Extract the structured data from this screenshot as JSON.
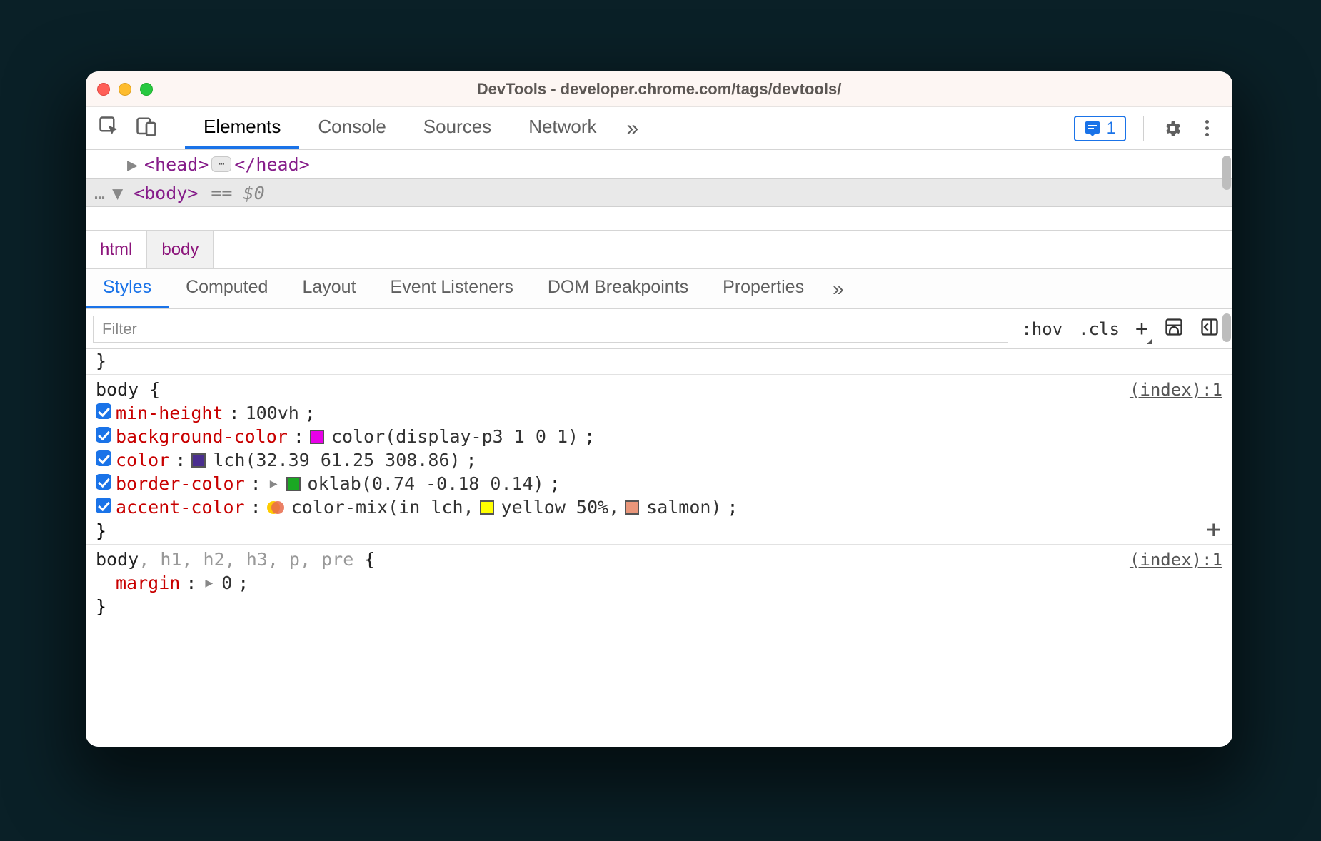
{
  "window": {
    "title": "DevTools - developer.chrome.com/tags/devtools/"
  },
  "main_tabs": {
    "items": [
      "Elements",
      "Console",
      "Sources",
      "Network"
    ],
    "active_index": 0,
    "overflow_glyph": "»"
  },
  "issue_chip": {
    "count": "1"
  },
  "dom": {
    "head_open": "<head>",
    "head_close": "</head>",
    "head_badge": "⋯",
    "body_open": "<body>",
    "eq_prefix": "==",
    "eq_var": "$0",
    "selected_dots": "…"
  },
  "breadcrumb": {
    "items": [
      "html",
      "body"
    ],
    "active_index": 1
  },
  "sub_tabs": {
    "items": [
      "Styles",
      "Computed",
      "Layout",
      "Event Listeners",
      "DOM Breakpoints",
      "Properties"
    ],
    "active_index": 0,
    "overflow_glyph": "»"
  },
  "filterbar": {
    "placeholder": "Filter",
    "hov": ":hov",
    "cls": ".cls",
    "plus": "+"
  },
  "rules": [
    {
      "selector_main": "body",
      "selector_dim": "",
      "open": "{",
      "close": "}",
      "source": "(index):1",
      "show_add": true,
      "declarations": [
        {
          "checked": true,
          "prop": "min-height",
          "value_plain": "100vh"
        },
        {
          "checked": true,
          "prop": "background-color",
          "swatches": [
            {
              "c": "#e800e8"
            }
          ],
          "value_plain": "color(display-p3 1 0 1)"
        },
        {
          "checked": true,
          "prop": "color",
          "swatches": [
            {
              "c": "#4a2e8f"
            }
          ],
          "value_plain": "lch(32.39 61.25 308.86)"
        },
        {
          "checked": true,
          "prop": "border-color",
          "expand": true,
          "swatches": [
            {
              "c": "#1aa823"
            }
          ],
          "value_plain": "oklab(0.74 -0.18 0.14)"
        },
        {
          "checked": true,
          "prop": "accent-color",
          "mix": {
            "a": "#ffcc00",
            "b": "#e86a4a"
          },
          "value_segs": [
            {
              "t": "text",
              "v": "color-mix(in lch, "
            },
            {
              "t": "sw",
              "c": "#ffff00"
            },
            {
              "t": "text",
              "v": "yellow 50%, "
            },
            {
              "t": "sw",
              "c": "#e9967a"
            },
            {
              "t": "text",
              "v": "salmon)"
            }
          ]
        }
      ]
    },
    {
      "selector_main": "body",
      "selector_dim": ", h1, h2, h3, p, pre",
      "open": "{",
      "close": "}",
      "source": "(index):1",
      "show_add": false,
      "declarations": [
        {
          "checked": false,
          "prop": "margin",
          "expand": true,
          "value_plain": "0"
        }
      ]
    }
  ]
}
